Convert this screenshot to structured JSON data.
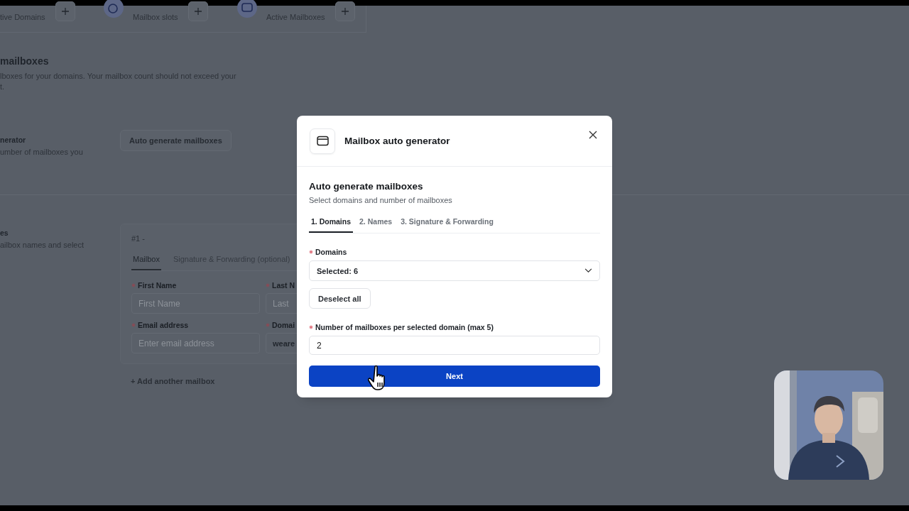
{
  "stats": [
    {
      "label": "tive Domains"
    },
    {
      "label": "Mailbox slots"
    },
    {
      "label": "Active Mailboxes"
    }
  ],
  "section": {
    "title": "mailboxes",
    "description": [
      "lboxes for your domains. Your mailbox count should not exceed your",
      "t."
    ]
  },
  "generator": {
    "title": "nerator",
    "description": "umber of mailboxes you",
    "button": "Auto generate mailboxes"
  },
  "mailboxes": {
    "title": "es",
    "description": "ailbox names and select",
    "card_title": "#1 -",
    "tabs": [
      {
        "label": "Mailbox",
        "selected": true
      },
      {
        "label": "Signature & Forwarding (optional)",
        "selected": false
      }
    ],
    "fields": [
      {
        "label": "First Name",
        "required": true,
        "placeholder": "First Name"
      },
      {
        "label": "Last N",
        "required": true,
        "placeholder": "Last"
      },
      {
        "label": "Email address",
        "required": true,
        "placeholder": "Enter email address"
      },
      {
        "label": "Domai",
        "required": true,
        "value": "weare"
      }
    ],
    "add_link": "+ Add another mailbox"
  },
  "modal": {
    "title": "Mailbox auto generator",
    "heading": "Auto generate mailboxes",
    "subheading": "Select domains and number of mailboxes",
    "tabs": [
      {
        "label": "1. Domains",
        "selected": true
      },
      {
        "label": "2. Names",
        "selected": false
      },
      {
        "label": "3. Signature & Forwarding",
        "selected": false
      }
    ],
    "domains_label": "Domains",
    "domains_required": true,
    "count_required": true,
    "domains_value": "Selected: 6",
    "deselect_button": "Deselect all",
    "count_label": "Number of mailboxes per selected domain (max 5)",
    "count_value": "2",
    "next_button": "Next"
  }
}
